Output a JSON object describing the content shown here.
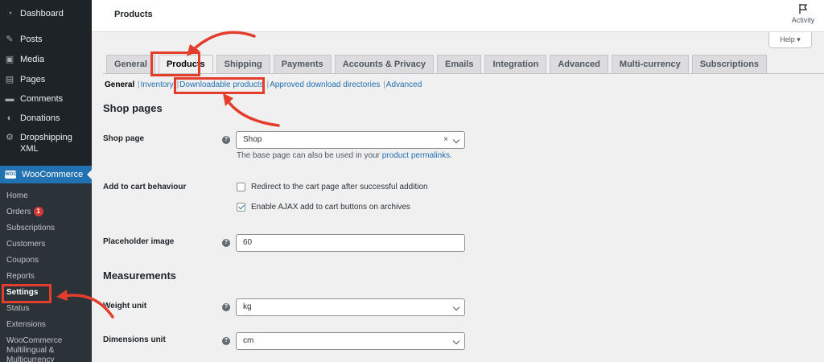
{
  "sidebar": {
    "top_items": [
      {
        "label": "Dashboard",
        "icon": "dashboard-icon"
      },
      {
        "label": "Posts",
        "icon": "pin-icon"
      },
      {
        "label": "Media",
        "icon": "media-icon"
      },
      {
        "label": "Pages",
        "icon": "page-icon"
      },
      {
        "label": "Comments",
        "icon": "comment-icon"
      },
      {
        "label": "Donations",
        "icon": "donation-icon"
      },
      {
        "label": "Dropshipping XML",
        "icon": "gear-icon"
      }
    ],
    "woocommerce_label": "WooCommerce",
    "woo_logo_text": "WOO",
    "submenu": [
      {
        "label": "Home"
      },
      {
        "label": "Orders",
        "badge": "1"
      },
      {
        "label": "Subscriptions"
      },
      {
        "label": "Customers"
      },
      {
        "label": "Coupons"
      },
      {
        "label": "Reports"
      },
      {
        "label": "Settings",
        "current": true
      },
      {
        "label": "Status"
      },
      {
        "label": "Extensions"
      },
      {
        "label": "WooCommerce Multilingual & Multicurrency"
      }
    ]
  },
  "topbar": {
    "title": "Products",
    "activity_label": "Activity",
    "help_label": "Help ▾"
  },
  "tabs": [
    "General",
    "Products",
    "Shipping",
    "Payments",
    "Accounts & Privacy",
    "Emails",
    "Integration",
    "Advanced",
    "Multi-currency",
    "Subscriptions"
  ],
  "active_tab": "Products",
  "subsections": {
    "current": "General",
    "links": [
      "Inventory",
      "Downloadable products",
      "Approved download directories",
      "Advanced"
    ],
    "separator": "|"
  },
  "shop_pages": {
    "heading": "Shop pages",
    "shop_page_label": "Shop page",
    "shop_page_value": "Shop",
    "shop_page_clear": "×",
    "description_prefix": "The base page can also be used in your ",
    "description_link": "product permalinks",
    "description_suffix": ".",
    "add_to_cart_label": "Add to cart behaviour",
    "option_redirect": "Redirect to the cart page after successful addition",
    "option_redirect_checked": false,
    "option_ajax": "Enable AJAX add to cart buttons on archives",
    "option_ajax_checked": true,
    "placeholder_label": "Placeholder image",
    "placeholder_value": "60"
  },
  "measurements": {
    "heading": "Measurements",
    "weight_label": "Weight unit",
    "weight_value": "kg",
    "dimensions_label": "Dimensions unit",
    "dimensions_value": "cm"
  },
  "help_tip_glyph": "?",
  "colors": {
    "sidebar_bg": "#1d2327",
    "active_menu": "#2271b1",
    "link": "#2271b1",
    "annotation": "#e23e2b",
    "badge": "#d63638"
  }
}
